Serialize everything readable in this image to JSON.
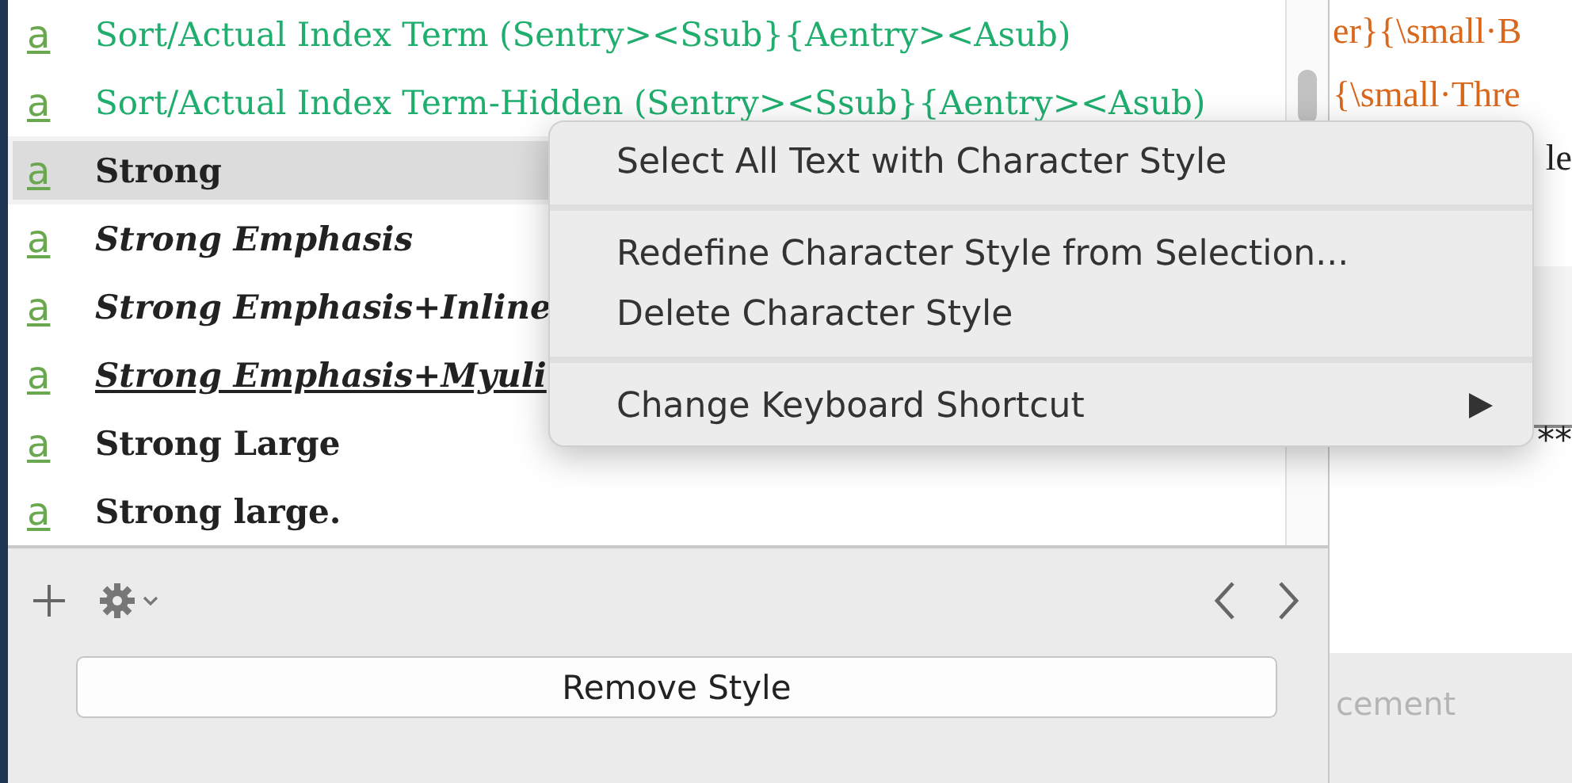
{
  "styles": [
    {
      "icon": "a",
      "name": "Sort/Actual Index Term (Sentry><Ssub}{Aentry><Asub)",
      "color": "#1fae6e",
      "bold": false,
      "italic": false,
      "underline": false,
      "selected": false
    },
    {
      "icon": "a",
      "name": "Sort/Actual Index Term-Hidden (Sentry><Ssub}{Aentry><Asub)",
      "color": "#1fae6e",
      "bold": false,
      "italic": false,
      "underline": false,
      "selected": false
    },
    {
      "icon": "a",
      "name": "Strong",
      "color": "#222222",
      "bold": true,
      "italic": false,
      "underline": false,
      "selected": true
    },
    {
      "icon": "a",
      "name": "Strong Emphasis",
      "color": "#222222",
      "bold": true,
      "italic": true,
      "underline": false,
      "selected": false
    },
    {
      "icon": "a",
      "name": "Strong Emphasis+Inline",
      "color": "#222222",
      "bold": true,
      "italic": true,
      "underline": false,
      "selected": false
    },
    {
      "icon": "a",
      "name": "Strong Emphasis+Myuli",
      "color": "#222222",
      "bold": true,
      "italic": true,
      "underline": true,
      "selected": false
    },
    {
      "icon": "a",
      "name": "Strong Large",
      "color": "#222222",
      "bold": true,
      "italic": false,
      "underline": false,
      "selected": false
    },
    {
      "icon": "a",
      "name": "Strong large.",
      "color": "#222222",
      "bold": true,
      "italic": false,
      "underline": false,
      "selected": false
    }
  ],
  "remove_button": "Remove Style",
  "document": {
    "lines": [
      "er}{\\small·B",
      "{\\small·Thre"
    ],
    "edge_text": "le",
    "marker": "**",
    "hint": "cement"
  },
  "context_menu": {
    "groups": [
      [
        {
          "label": "Select All Text with Character Style",
          "submenu": false
        }
      ],
      [
        {
          "label": "Redefine Character Style from Selection...",
          "submenu": false
        },
        {
          "label": "Delete Character Style",
          "submenu": false
        }
      ],
      [
        {
          "label": "Change Keyboard Shortcut",
          "submenu": true
        }
      ]
    ]
  }
}
